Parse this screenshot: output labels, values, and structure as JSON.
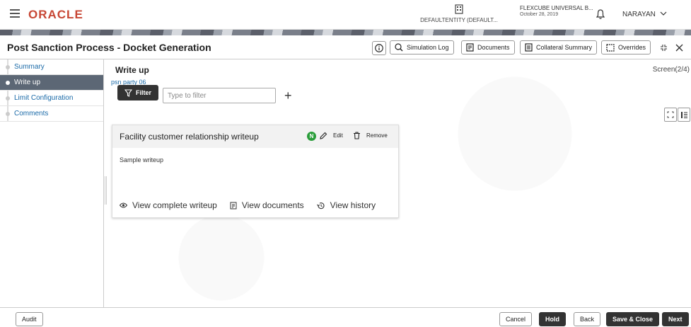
{
  "app": {
    "logo": "ORACLE",
    "entity": "DEFAULTENTITY (DEFAULT...",
    "product": "FLEXCUBE UNIVERSAL B...",
    "date": "October 28, 2019",
    "user": "NARAYAN"
  },
  "header": {
    "title": "Post Sanction Process - Docket Generation",
    "buttons": {
      "simulation": "Simulation Log",
      "documents": "Documents",
      "collateral": "Collateral Summary",
      "overrides": "Overrides"
    }
  },
  "sidebar": {
    "items": [
      {
        "label": "Summary"
      },
      {
        "label": "Write up"
      },
      {
        "label": "Limit Configuration"
      },
      {
        "label": "Comments"
      }
    ]
  },
  "main": {
    "title": "Write up",
    "screen": "Screen(2/4)",
    "party": "psn party 06",
    "filter_label": "Filter",
    "filter_placeholder": "Type to filter",
    "card": {
      "title": "Facility customer relationship writeup",
      "badge": "N",
      "edit": "Edit",
      "remove": "Remove",
      "body": "Sample writeup",
      "links": {
        "complete": "View complete writeup",
        "documents": "View documents",
        "history": "View history"
      }
    }
  },
  "footer": {
    "audit": "Audit",
    "cancel": "Cancel",
    "hold": "Hold",
    "back": "Back",
    "save_close": "Save & Close",
    "next": "Next"
  }
}
